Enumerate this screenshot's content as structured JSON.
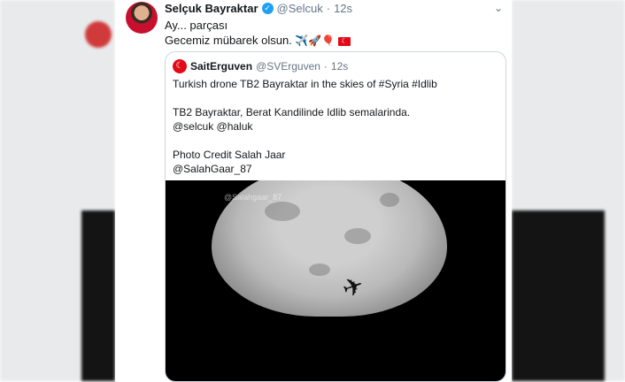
{
  "tweet": {
    "author_name": "Selçuk Bayraktar",
    "handle": "@Selcuk",
    "separator": "·",
    "time": "12s",
    "line1": "Ay... parçası",
    "line2": "Gecemiz mübarek olsun.",
    "emoji": "✈️🚀🎈",
    "menu_icon": "⌄"
  },
  "quoted_tweet": {
    "author_name": "SaitErguven",
    "handle": "@SVErguven",
    "separator": "·",
    "time": "12s",
    "lines": [
      "Turkish drone TB2 Bayraktar in the skies of #Syria #Idlib",
      "TB2 Bayraktar, Berat Kandilinde Idlib semalarinda.",
      "@selcuk @haluk",
      "Photo Credit Salah Jaar",
      "@SalahGaar_87"
    ]
  },
  "image": {
    "watermark": "@Salahgaar_87"
  },
  "colors": {
    "link_blue": "#1da1f2",
    "flag_red": "#e30a17"
  }
}
